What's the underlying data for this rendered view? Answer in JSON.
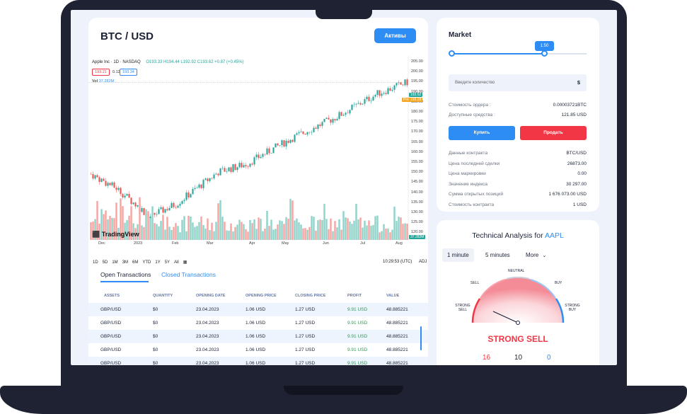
{
  "pair": {
    "title": "BTC / USD",
    "assets_button": "Активы"
  },
  "chart": {
    "symbol_line": "Apple Inc · 1D · NASDAQ",
    "ohlc": "O193.33 H194.44 L192.92 C193.62 +0.87 (+0.45%)",
    "tag_sell": "193.21",
    "tag_mid": "0.12",
    "tag_buy": "193.34",
    "vol_label": "Vol",
    "vol_value": "37.282M",
    "price_tag_1": "193.62",
    "price_tag_2": "193.28",
    "pre_label": "Pre",
    "vol_tag": "37.282M",
    "logo": "TradingView",
    "y_ticks": [
      "205.00",
      "200.00",
      "195.00",
      "190.00",
      "185.00",
      "180.00",
      "175.00",
      "170.00",
      "165.00",
      "160.00",
      "155.00",
      "150.00",
      "145.00",
      "140.00",
      "135.00",
      "130.00",
      "125.00",
      "120.00"
    ],
    "x_ticks": [
      "Dec",
      "2023",
      "Feb",
      "Mar",
      "Apr",
      "May",
      "Jun",
      "Jul",
      "Aug"
    ],
    "timeframes": [
      "1D",
      "5D",
      "1M",
      "3M",
      "6M",
      "YTD",
      "1Y",
      "5Y",
      "All"
    ],
    "time": "10:29:53 (UTC)",
    "adj": "ADJ"
  },
  "transactions": {
    "tab_open": "Open Transactions",
    "tab_closed": "Closed Transactions",
    "columns": [
      "ASSETS",
      "QUANTITY",
      "OPENING DATE",
      "OPENING PRICE",
      "CLOSING PRICE",
      "PROFIT",
      "VALUE"
    ],
    "rows": [
      [
        "GBP/USD",
        "$0",
        "23.04.2023",
        "1.06 USD",
        "1.27 USD",
        "9.91 USD",
        "48.885221"
      ],
      [
        "GBP/USD",
        "$0",
        "23.04.2023",
        "1.06 USD",
        "1.27 USD",
        "9.91 USD",
        "48.885221"
      ],
      [
        "GBP/USD",
        "$0",
        "23.04.2023",
        "1.06 USD",
        "1.27 USD",
        "9.91 USD",
        "48.885221"
      ],
      [
        "GBP/USD",
        "$0",
        "23.04.2023",
        "1.06 USD",
        "1.27 USD",
        "9.91 USD",
        "48.885221"
      ],
      [
        "GBP/USD",
        "$0",
        "23.04.2023",
        "1.06 USD",
        "1.27 USD",
        "9.91 USD",
        "48.885221"
      ]
    ]
  },
  "market": {
    "title": "Market",
    "slider_value": "1:50",
    "slider_fraction": 0.69,
    "qty_placeholder": "Введите количество",
    "qty_currency": "$",
    "order_cost_label": "Стоимость ордера :",
    "order_cost_value": "0.00003721BTC",
    "available_label": "Доступные средства :",
    "available_value": "121.85 USD",
    "buy": "Купить",
    "sell": "Продать",
    "contract_data_label": "Данные контракта",
    "contract_data_value": "BTC/USD",
    "last_price_label": "Цена последней сделки",
    "last_price_value": "26873.00",
    "mark_price_label": "Цена маркировки",
    "mark_price_value": "0.00",
    "index_label": "Значение индекса",
    "index_value": "30 297.00",
    "oi_label": "Сумма открытых позиций",
    "oi_value": "1 676 073.00 USD",
    "contract_cost_label": "Стоимость контракта",
    "contract_cost_value": "1 USD"
  },
  "technical": {
    "title": "Technical Analysis for",
    "symbol": "AAPL",
    "tabs": [
      "1 minute",
      "5 minutes",
      "More"
    ],
    "gauge_labels": {
      "strong_sell": "STRONG\nSELL",
      "sell": "SELL",
      "neutral": "NEUTRAL",
      "buy": "BUY",
      "strong_buy": "STRONG\nBUY"
    },
    "verdict": "STRONG SELL",
    "counts": {
      "sell": "16",
      "neutral": "10",
      "buy": "0"
    },
    "colors": {
      "sell": "#f23645",
      "buy": "#2e8cf5",
      "neutral": "#1b2236"
    }
  }
}
